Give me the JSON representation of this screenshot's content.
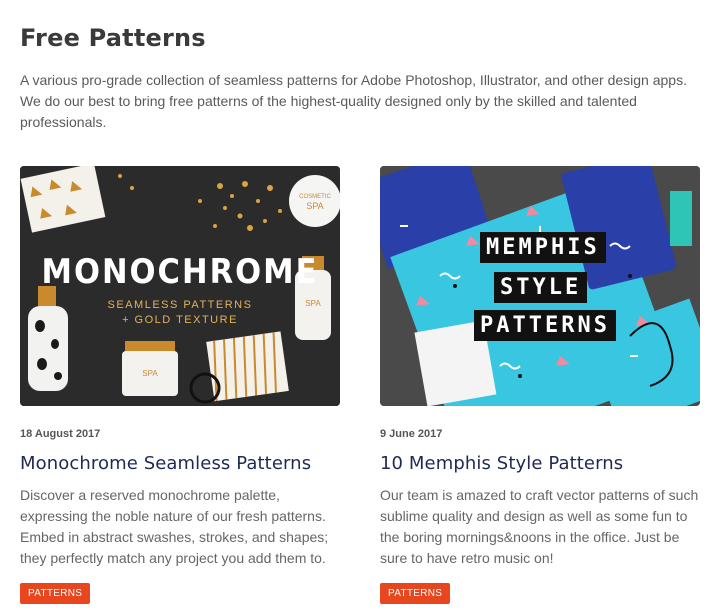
{
  "page": {
    "title": "Free Patterns",
    "intro": "A various pro-grade collection of seamless patterns for Adobe Photoshop, Illustrator, and other design apps. We do our best to bring free patterns of the highest-quality designed only by the skilled and talented professionals."
  },
  "posts": [
    {
      "date": "18 August 2017",
      "title": "Monochrome Seamless Patterns",
      "excerpt": "Discover a reserved monochrome palette, expressing the noble nature of our fresh patterns. Embed in abstract swashes, strokes, and shapes; they perfectly match any project you add them to.",
      "tag": "PATTERNS",
      "thumb_heading": "MONOCHROME",
      "thumb_sub_1": "SEAMLESS PATTERNS",
      "thumb_sub_2": "+ GOLD TEXTURE",
      "thumb_label_spa_1": "SPA",
      "thumb_label_spa_2": "SPA",
      "thumb_label_spa_3": "SPA"
    },
    {
      "date": "9 June 2017",
      "title": "10 Memphis Style Patterns",
      "excerpt": "Our team is amazed to craft vector patterns of such sublime quality and design as well as some fun to the boring mornings&noons in the office. Just be sure to have retro music on!",
      "tag": "PATTERNS",
      "thumb_word_1": "MEMPHIS",
      "thumb_word_2": "STYLE",
      "thumb_word_3": "PATTERNS"
    }
  ],
  "colors": {
    "tag_bg": "#e8461e",
    "title_color": "#1e2a52",
    "gold": "#d9a441",
    "memphis_cyan": "#38c6e0",
    "memphis_navy": "#2a3fa8"
  }
}
